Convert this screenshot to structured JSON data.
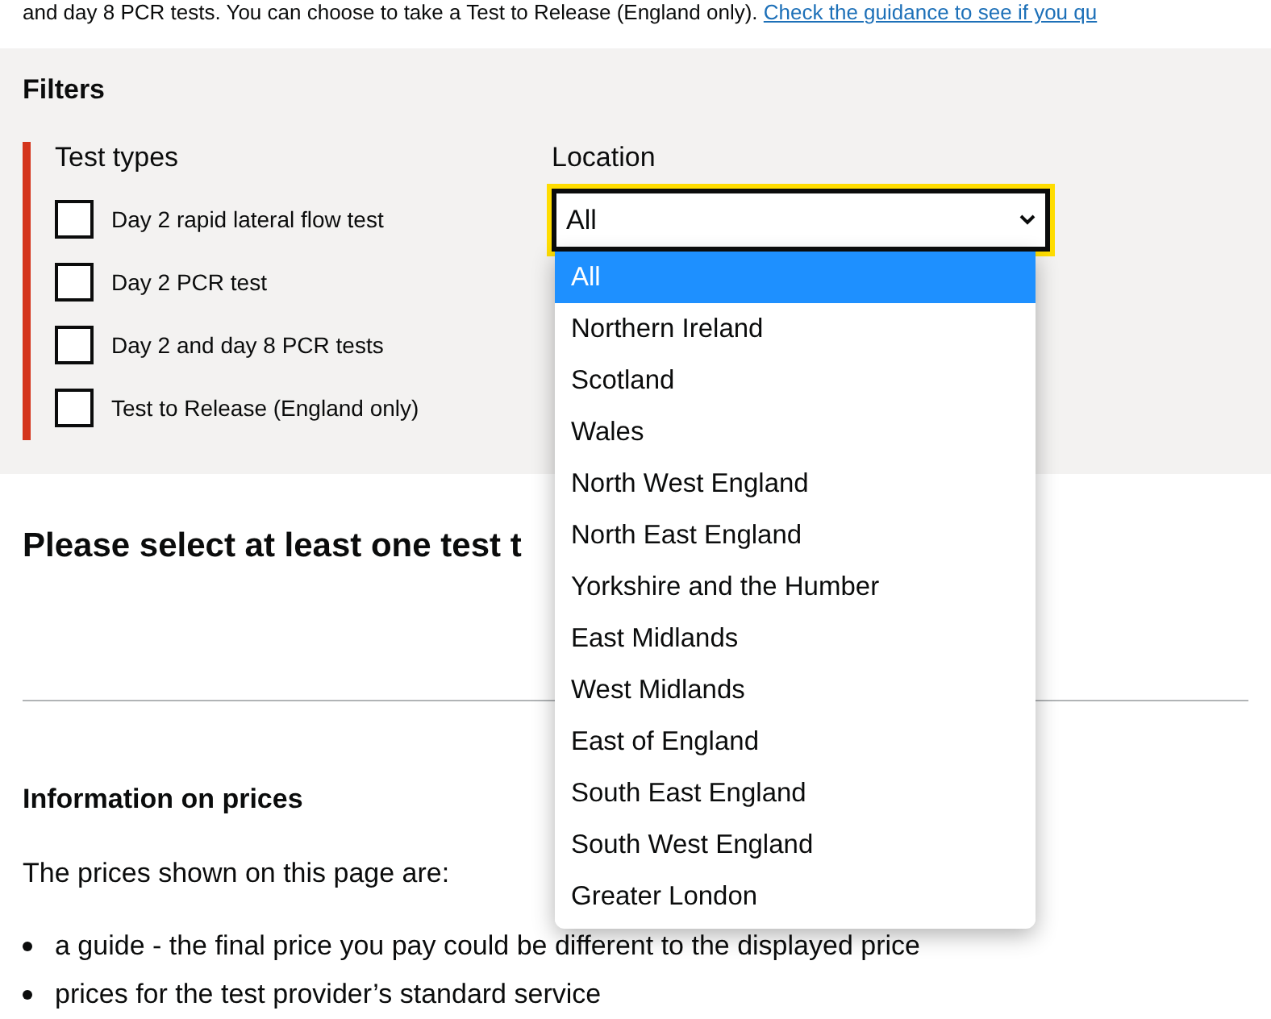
{
  "intro": {
    "text": "and day 8 PCR tests. You can choose to take a Test to Release (England only).",
    "link": "Check the guidance to see if you qu"
  },
  "filters": {
    "title": "Filters",
    "test_types": {
      "legend": "Test types",
      "options": [
        {
          "label": "Day 2 rapid lateral flow test",
          "checked": false
        },
        {
          "label": "Day 2 PCR test",
          "checked": false
        },
        {
          "label": "Day 2 and day 8 PCR tests",
          "checked": false
        },
        {
          "label": "Test to Release (England only)",
          "checked": false
        }
      ]
    },
    "location": {
      "label": "Location",
      "value": "All",
      "expanded": true,
      "options": [
        {
          "label": "All",
          "selected": true
        },
        {
          "label": "Northern Ireland",
          "selected": false
        },
        {
          "label": "Scotland",
          "selected": false
        },
        {
          "label": "Wales",
          "selected": false
        },
        {
          "label": "North West England",
          "selected": false
        },
        {
          "label": "North East England",
          "selected": false
        },
        {
          "label": "Yorkshire and the Humber",
          "selected": false
        },
        {
          "label": "East Midlands",
          "selected": false
        },
        {
          "label": "West Midlands",
          "selected": false
        },
        {
          "label": "East of England",
          "selected": false
        },
        {
          "label": "South East England",
          "selected": false
        },
        {
          "label": "South West England",
          "selected": false
        },
        {
          "label": "Greater London",
          "selected": false
        }
      ]
    }
  },
  "results_message": "Please select at least one test t",
  "prices": {
    "heading": "Information on prices",
    "intro": "The prices shown on this page are:",
    "bullets": [
      "a guide - the final price you pay could be different to the displayed price",
      "prices for the test provider’s standard service"
    ]
  }
}
